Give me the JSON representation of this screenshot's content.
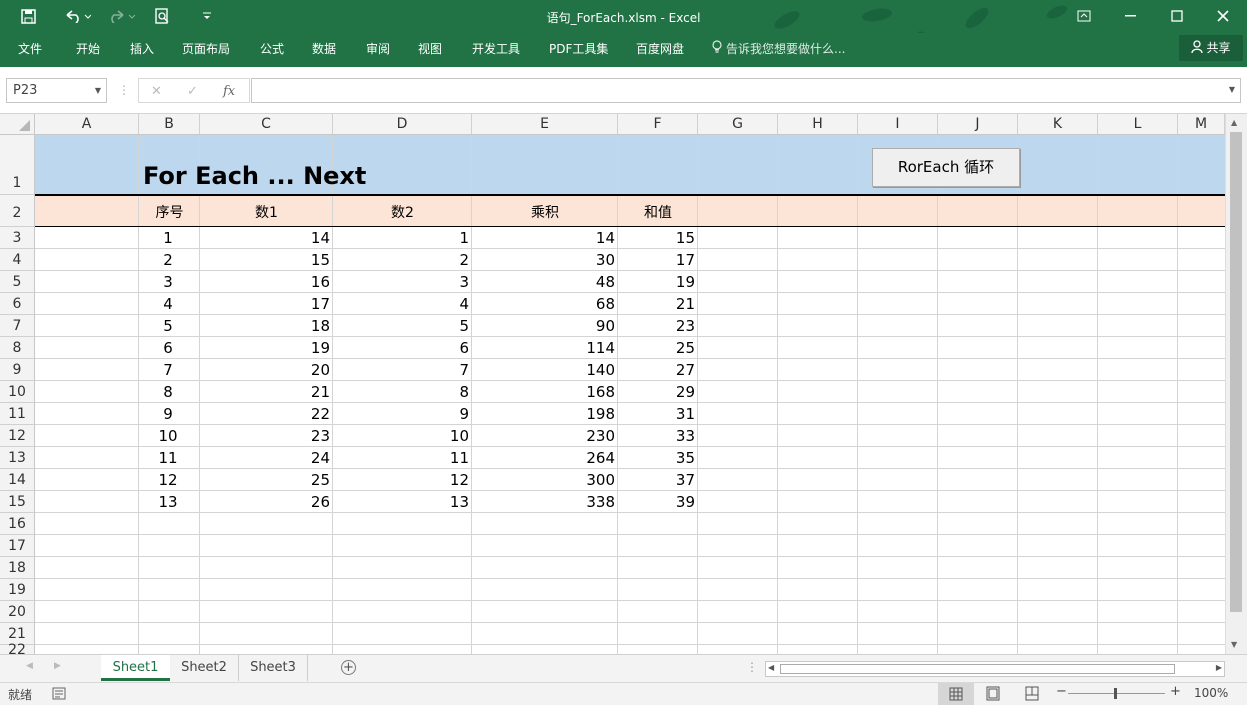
{
  "window": {
    "title": "语句_ForEach.xlsm - Excel",
    "icons": [
      "save-icon",
      "undo-icon",
      "redo-icon",
      "print-preview-icon",
      "customize-icon",
      "ribbon-display-icon",
      "minimize-icon",
      "maximize-icon",
      "close-icon"
    ]
  },
  "ribbon": {
    "tabs": [
      "文件",
      "开始",
      "插入",
      "页面布局",
      "公式",
      "数据",
      "审阅",
      "视图",
      "开发工具",
      "PDF工具集",
      "百度网盘"
    ],
    "tell_me": "告诉我您想要做什么...",
    "share": "共享"
  },
  "formula_bar": {
    "name_box": "P23",
    "fx": "fx",
    "formula": ""
  },
  "grid": {
    "columns": [
      "A",
      "B",
      "C",
      "D",
      "E",
      "F",
      "G",
      "H",
      "I",
      "J",
      "K",
      "L",
      "M"
    ],
    "rows": [
      "1",
      "2",
      "3",
      "4",
      "5",
      "6",
      "7",
      "8",
      "9",
      "10",
      "11",
      "12",
      "13",
      "14",
      "15",
      "16",
      "17",
      "18",
      "19",
      "20",
      "21",
      "22"
    ],
    "title": "For Each ... Next",
    "button": "RorEach 循环",
    "headers": [
      "序号",
      "数1",
      "数2",
      "乘积",
      "和值"
    ],
    "data": [
      [
        "1",
        "14",
        "1",
        "14",
        "15"
      ],
      [
        "2",
        "15",
        "2",
        "30",
        "17"
      ],
      [
        "3",
        "16",
        "3",
        "48",
        "19"
      ],
      [
        "4",
        "17",
        "4",
        "68",
        "21"
      ],
      [
        "5",
        "18",
        "5",
        "90",
        "23"
      ],
      [
        "6",
        "19",
        "6",
        "114",
        "25"
      ],
      [
        "7",
        "20",
        "7",
        "140",
        "27"
      ],
      [
        "8",
        "21",
        "8",
        "168",
        "29"
      ],
      [
        "9",
        "22",
        "9",
        "198",
        "31"
      ],
      [
        "10",
        "23",
        "10",
        "230",
        "33"
      ],
      [
        "11",
        "24",
        "11",
        "264",
        "35"
      ],
      [
        "12",
        "25",
        "12",
        "300",
        "37"
      ],
      [
        "13",
        "26",
        "13",
        "338",
        "39"
      ]
    ]
  },
  "sheets": [
    "Sheet1",
    "Sheet2",
    "Sheet3"
  ],
  "status": {
    "ready": "就绪",
    "zoom": "100%"
  },
  "colors": {
    "accent": "#217346",
    "title_row": "#bdd7ee",
    "header_row": "#fce4d6"
  }
}
